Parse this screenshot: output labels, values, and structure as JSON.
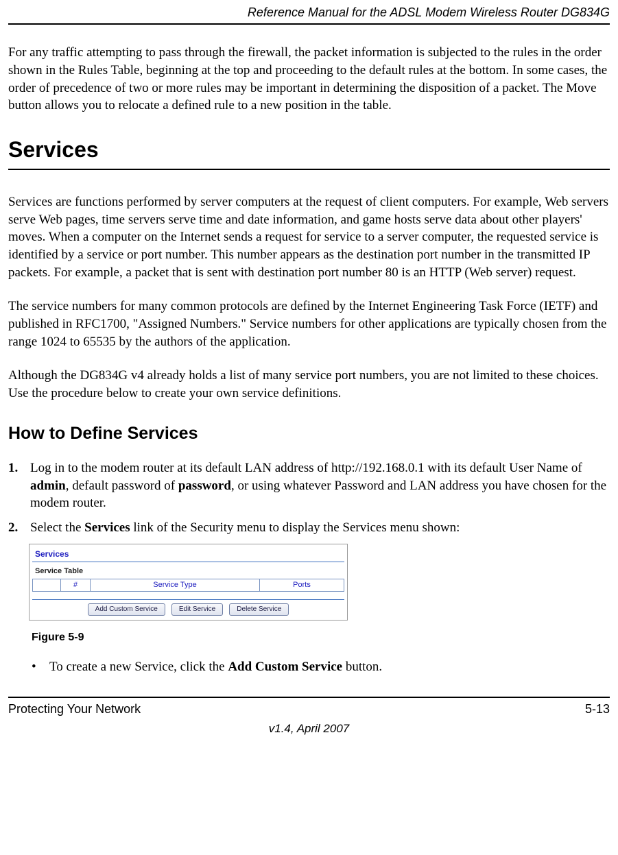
{
  "header": {
    "title": "Reference Manual for the ADSL Modem Wireless Router DG834G"
  },
  "para1": "For any traffic attempting to pass through the firewall, the packet information is subjected to the rules in the order shown in the Rules Table, beginning at the top and proceeding to the default rules at the bottom. In some cases, the order of precedence of two or more rules may be important in determining the disposition of a packet. The Move button allows you to relocate a defined rule to a new position in the table.",
  "section_services": {
    "heading": "Services",
    "p1": "Services are functions performed by server computers at the request of client computers. For example, Web servers serve Web pages, time servers serve time and date information, and game hosts serve data about other players' moves. When a computer on the Internet sends a request for service to a server computer, the requested service is identified by a service or port number. This number appears as the destination port number in the transmitted IP packets. For example, a packet that is sent with destination port number 80 is an HTTP (Web server) request.",
    "p2": "The service numbers for many common protocols are defined by the Internet Engineering Task Force (IETF) and published in RFC1700, \"Assigned Numbers.\" Service numbers for other applications are typically chosen from the range 1024 to 65535 by the authors of the application.",
    "p3": "Although the DG834G v4 already holds a list of many service port numbers, you are not limited to these choices. Use the procedure below to create your own service definitions."
  },
  "subsection_define": {
    "heading": "How to Define Services",
    "steps": {
      "s1_pre": "Log in to the modem router at its default LAN address of http://192.168.0.1 with its default User Name of ",
      "s1_b1": "admin",
      "s1_mid1": ", default password of ",
      "s1_b2": "password",
      "s1_post": ", or using whatever Password and LAN address you have chosen for the modem router.",
      "s2_pre": "Select the ",
      "s2_b": "Services",
      "s2_post": " link of the Security menu to display the Services menu shown:"
    },
    "figure": {
      "title": "Services",
      "subtitle": "Service Table",
      "th_num": "#",
      "th_type": "Service Type",
      "th_ports": "Ports",
      "btn_add": "Add Custom Service",
      "btn_edit": "Edit Service",
      "btn_delete": "Delete Service",
      "caption": "Figure 5-9"
    },
    "bullet": {
      "pre": "To create a new Service, click the ",
      "b": "Add Custom Service",
      "post": " button."
    }
  },
  "footer": {
    "left": "Protecting Your Network",
    "right": "5-13",
    "center": "v1.4, April 2007"
  }
}
